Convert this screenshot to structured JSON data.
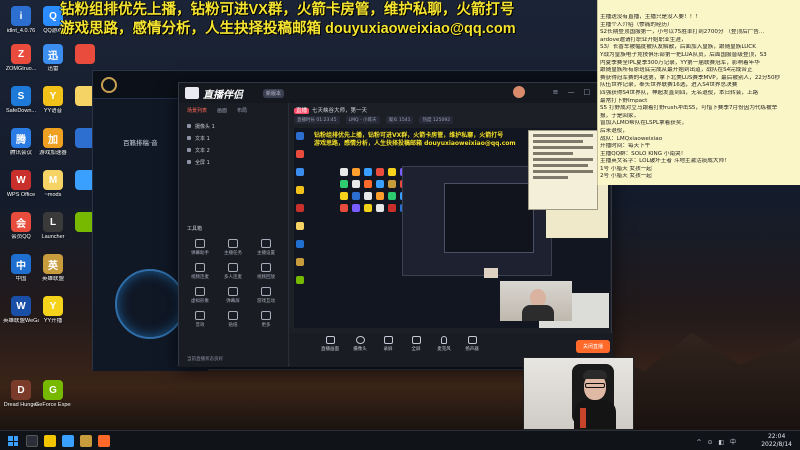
{
  "overlay": {
    "line1": "钻粉组排优先上播，钻粉可进VX群，火箭卡房管，维护私聊，火箭打号",
    "line2": "游戏思路，感情分析，人生抉择投稿邮箱 douyuxiaoweixiao@qq.com"
  },
  "desktop_icons": [
    {
      "label": "idlnt_4.0.76",
      "color": "#2d6fd1",
      "glyph": "i"
    },
    {
      "label": "QQ游戏",
      "color": "#2a8cff",
      "glyph": "Q"
    },
    {
      "label": "ZOMGtruo...",
      "color": "#e94c3d",
      "glyph": "Z"
    },
    {
      "label": "迅雷",
      "color": "#3c8df0",
      "glyph": "迅"
    },
    {
      "label": "SafeDown...",
      "color": "#1d7ad8",
      "glyph": "S"
    },
    {
      "label": "YY语音",
      "color": "#f3c21a",
      "glyph": "Y"
    },
    {
      "label": "腾讯会议",
      "color": "#2b7be5",
      "glyph": "腾"
    },
    {
      "label": "游戏加速器",
      "color": "#f0a020",
      "glyph": "加"
    },
    {
      "label": "WPS Office",
      "color": "#c9302c",
      "glyph": "W"
    },
    {
      "label": "~mods",
      "color": "#f6d365",
      "glyph": "M"
    },
    {
      "label": "会员QQ",
      "color": "#e74c3c",
      "glyph": "会"
    },
    {
      "label": "Launcher",
      "color": "#3a3a3a",
      "glyph": "L"
    },
    {
      "label": "中国",
      "color": "#1f6fd1",
      "glyph": "中"
    },
    {
      "label": "英雄联盟",
      "color": "#c89b3c",
      "glyph": "英"
    },
    {
      "label": "英雄联盟WeGame版",
      "color": "#1a4fa8",
      "glyph": "W"
    },
    {
      "label": "YY开播",
      "color": "#f5d31a",
      "glyph": "Y"
    },
    {
      "label": "Dread Hunger",
      "color": "#7a3b2a",
      "glyph": "D"
    },
    {
      "label": "GeForce Experience",
      "color": "#76b900",
      "glyph": "G"
    }
  ],
  "game_client": {
    "title": "百籁排稿·音"
  },
  "stream_app": {
    "title": "直播伴侣",
    "badge": "新版本",
    "tabs": [
      "场景列表",
      "画面",
      "布局"
    ],
    "scenes": [
      "摄像头 1",
      "文本 1",
      "文本 2",
      "全屏 1"
    ],
    "tools_title": "工具箱",
    "tools": [
      "弹幕助手",
      "主播任务",
      "主播设置",
      "视频连麦",
      "多人连麦",
      "视频回放",
      "虚拟形象",
      "弹幕屏",
      "游戏互动",
      "音效",
      "贴纸",
      "更多"
    ],
    "footer": "当前直播状态良好",
    "room_tag": "直播",
    "room_title": "七天峡谷大师，第一天",
    "stats": [
      "直播时长 01:23:45",
      "LMQ - 小蒋天",
      "观众 1541",
      "热度 125092"
    ],
    "bottom_controls": [
      "直播画面",
      "摄像头",
      "录屏",
      "全屏",
      "麦克风",
      "扬声器"
    ],
    "live_button": "关闭直播"
  },
  "note": {
    "lines": [
      "主播送没有直播，主播只是没人要！！！",
      "主播个人介绍（惨痛的经历）",
      "   S2长期登顶国服第一，小号以75胜率打到2700分 （登顶后广告...",
      "ardove邀请打职业开始职业生涯，",
      "   S3厂长香车被幅度被队友解散，后面加入皇族，跟随皇族LUCK",
      "Y战为皇族电子竞技俱乐部第一把LUA队员，后面国服晋级登顶，S3",
      "内夏季赛全IPL夏季300万记录，YY第一届联赛冠军，影响着年华",
      "   跟随皇族所有原班底完成从最开始到出道，战队在S4完成合正",
      "赛获得冠军赛的4选第，拿下北美LUS赛季MVP，最后被别人，22分50秒",
      "队伍世界记录，奉头世界联赛16选，进入S4世界总决赛",
      "四强获得S4世界队，神超发直到四，无名退役，本日转会，上路",
      "最常打下野Impact",
      "   S5 打野成对立马跟着打野rush冲击S5，可惜下赛季7月份因为代练被举",
      "报，于是回家，",
      "曾加入LMO帮队在LSPL拿着获奖，",
      "后来退役，",
      "   战队：LMQxiaoweixiao",
      "开播时间：每天下午",
      "主播QQ群：SOLO KING 小南哭！",
      "主播英文名字：LOL破坏王者 斗地主激活痰成大师！",
      "1号  小腊天 女孩一起",
      "2号  小腊天 女孩一起"
    ]
  },
  "taskbar": {
    "tray": "^ ⊙ ◧ 中",
    "time": "22:04",
    "date": "2022/8/14"
  }
}
